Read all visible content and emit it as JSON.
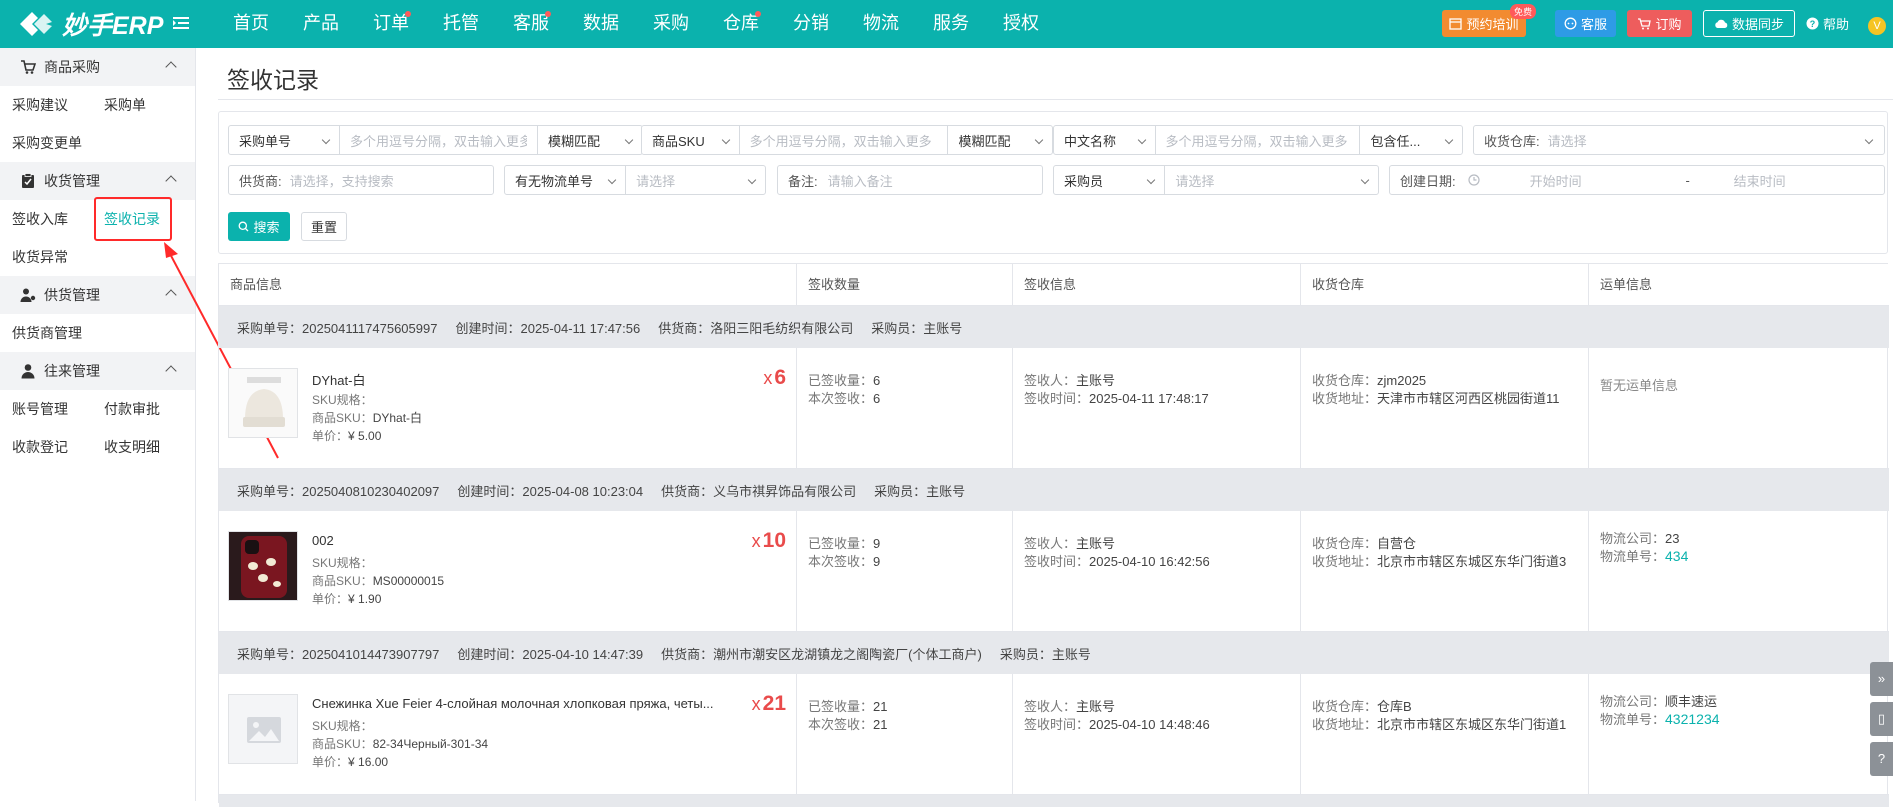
{
  "app": {
    "name": "妙手ERP"
  },
  "nav": {
    "items": [
      {
        "label": "首页",
        "dot": false
      },
      {
        "label": "产品",
        "dot": false
      },
      {
        "label": "订单",
        "dot": true
      },
      {
        "label": "托管",
        "dot": false
      },
      {
        "label": "客服",
        "dot": true
      },
      {
        "label": "数据",
        "dot": false
      },
      {
        "label": "采购",
        "dot": false
      },
      {
        "label": "仓库",
        "dot": true
      },
      {
        "label": "分销",
        "dot": false
      },
      {
        "label": "物流",
        "dot": false
      },
      {
        "label": "服务",
        "dot": false
      },
      {
        "label": "授权",
        "dot": false
      }
    ]
  },
  "toolbar": {
    "training": "预约培训",
    "free_badge": "免费",
    "service": "客服",
    "order": "订购",
    "sync": "数据同步",
    "help": "帮助",
    "avatar": "V"
  },
  "sidebar": {
    "groups": [
      {
        "title": "商品采购",
        "icon": "cart-icon",
        "items": [
          "采购建议",
          "采购单",
          "采购变更单"
        ]
      },
      {
        "title": "收货管理",
        "icon": "clipboard-icon",
        "items": [
          "签收入库",
          "签收记录",
          "收货异常"
        ]
      },
      {
        "title": "供货管理",
        "icon": "supplier-icon",
        "items": [
          "供货商管理"
        ]
      },
      {
        "title": "往来管理",
        "icon": "user-icon",
        "items": [
          "账号管理",
          "付款审批",
          "收款登记",
          "收支明细"
        ]
      }
    ],
    "active_item": "签收记录"
  },
  "page": {
    "title": "签收记录"
  },
  "filters": {
    "po_no_select": "采购单号",
    "po_no_placeholder": "多个用逗号分隔，双击输入更多",
    "po_match": "模糊匹配",
    "sku_select": "商品SKU",
    "sku_placeholder": "多个用逗号分隔，双击输入更多",
    "sku_match": "模糊匹配",
    "cn_name_select": "中文名称",
    "cn_name_placeholder": "多个用逗号分隔，双击输入更多",
    "cn_name_match": "包含任...",
    "warehouse_label": "收货仓库:",
    "warehouse_placeholder": "请选择",
    "supplier_label": "供货商:",
    "supplier_placeholder": "请选择，支持搜索",
    "tracking_select": "有无物流单号",
    "tracking_placeholder": "请选择",
    "remark_label": "备注:",
    "remark_placeholder": "请输入备注",
    "buyer_select": "采购员",
    "buyer_placeholder": "请选择",
    "date_label": "创建日期:",
    "date_start": "开始时间",
    "date_sep": "-",
    "date_end": "结束时间",
    "search_btn": "搜索",
    "reset_btn": "重置"
  },
  "table": {
    "columns": [
      "商品信息",
      "签收数量",
      "签收信息",
      "收货仓库",
      "运单信息"
    ],
    "groups": [
      {
        "po_label": "采购单号：",
        "po_no": "2025041117475605997",
        "created_label": "创建时间：",
        "created": "2025-04-11 17:47:56",
        "supplier_label": "供货商：",
        "supplier": "洛阳三阳毛纺织有限公司",
        "buyer_label": "采购员：",
        "buyer": "主账号",
        "item": {
          "name": "DYhat-白",
          "image": "hat",
          "spec_label": "SKU规格：",
          "spec": "",
          "sku_label": "商品SKU：",
          "sku": "DYhat-白",
          "price_label": "单价：",
          "price": "¥ 5.00",
          "qty_prefix": "x",
          "qty": "6",
          "received_label": "已签收量：",
          "received": "6",
          "this_label": "本次签收：",
          "this": "6",
          "signer_label": "签收人：",
          "signer": "主账号",
          "sign_time_label": "签收时间：",
          "sign_time": "2025-04-11 17:48:17",
          "wh_label": "收货仓库：",
          "wh": "zjm2025",
          "addr_label": "收货地址：",
          "addr": "天津市市辖区河西区桃园街道11",
          "no_waybill": "暂无运单信息",
          "carrier_label": "",
          "carrier": "",
          "tracking_label": "",
          "tracking": ""
        }
      },
      {
        "po_label": "采购单号：",
        "po_no": "2025040810230402097",
        "created_label": "创建时间：",
        "created": "2025-04-08 10:23:04",
        "supplier_label": "供货商：",
        "supplier": "义乌市祺昇饰品有限公司",
        "buyer_label": "采购员：",
        "buyer": "主账号",
        "item": {
          "name": "002",
          "image": "phonecase",
          "spec_label": "SKU规格：",
          "spec": "",
          "sku_label": "商品SKU：",
          "sku": "MS00000015",
          "price_label": "单价：",
          "price": "¥ 1.90",
          "qty_prefix": "x",
          "qty": "10",
          "received_label": "已签收量：",
          "received": "9",
          "this_label": "本次签收：",
          "this": "9",
          "signer_label": "签收人：",
          "signer": "主账号",
          "sign_time_label": "签收时间：",
          "sign_time": "2025-04-10 16:42:56",
          "wh_label": "收货仓库：",
          "wh": "自营仓",
          "addr_label": "收货地址：",
          "addr": "北京市市辖区东城区东华门街道3",
          "no_waybill": "",
          "carrier_label": "物流公司：",
          "carrier": "23",
          "tracking_label": "物流单号：",
          "tracking": "434"
        }
      },
      {
        "po_label": "采购单号：",
        "po_no": "2025041014473907797",
        "created_label": "创建时间：",
        "created": "2025-04-10 14:47:39",
        "supplier_label": "供货商：",
        "supplier": "潮州市潮安区龙湖镇龙之阁陶瓷厂(个体工商户)",
        "buyer_label": "采购员：",
        "buyer": "主账号",
        "item": {
          "name": "Снежинка Xue Feier 4-слойная молочная хлопковая пряжа, четы...",
          "image": "placeholder",
          "spec_label": "SKU规格：",
          "spec": "",
          "sku_label": "商品SKU：",
          "sku": "82-34Черный-301-34",
          "price_label": "单价：",
          "price": "¥ 16.00",
          "qty_prefix": "x",
          "qty": "21",
          "received_label": "已签收量：",
          "received": "21",
          "this_label": "本次签收：",
          "this": "21",
          "signer_label": "签收人：",
          "signer": "主账号",
          "sign_time_label": "签收时间：",
          "sign_time": "2025-04-10 14:48:46",
          "wh_label": "收货仓库：",
          "wh": "仓库B",
          "addr_label": "收货地址：",
          "addr": "北京市市辖区东城区东华门街道1",
          "no_waybill": "",
          "carrier_label": "物流公司：",
          "carrier": "顺丰速运",
          "tracking_label": "物流单号：",
          "tracking": "4321234"
        }
      }
    ]
  },
  "colors": {
    "brand": "#0bb2ad",
    "qty_red": "#e94b4b",
    "highlight": "#ff2a2a"
  }
}
